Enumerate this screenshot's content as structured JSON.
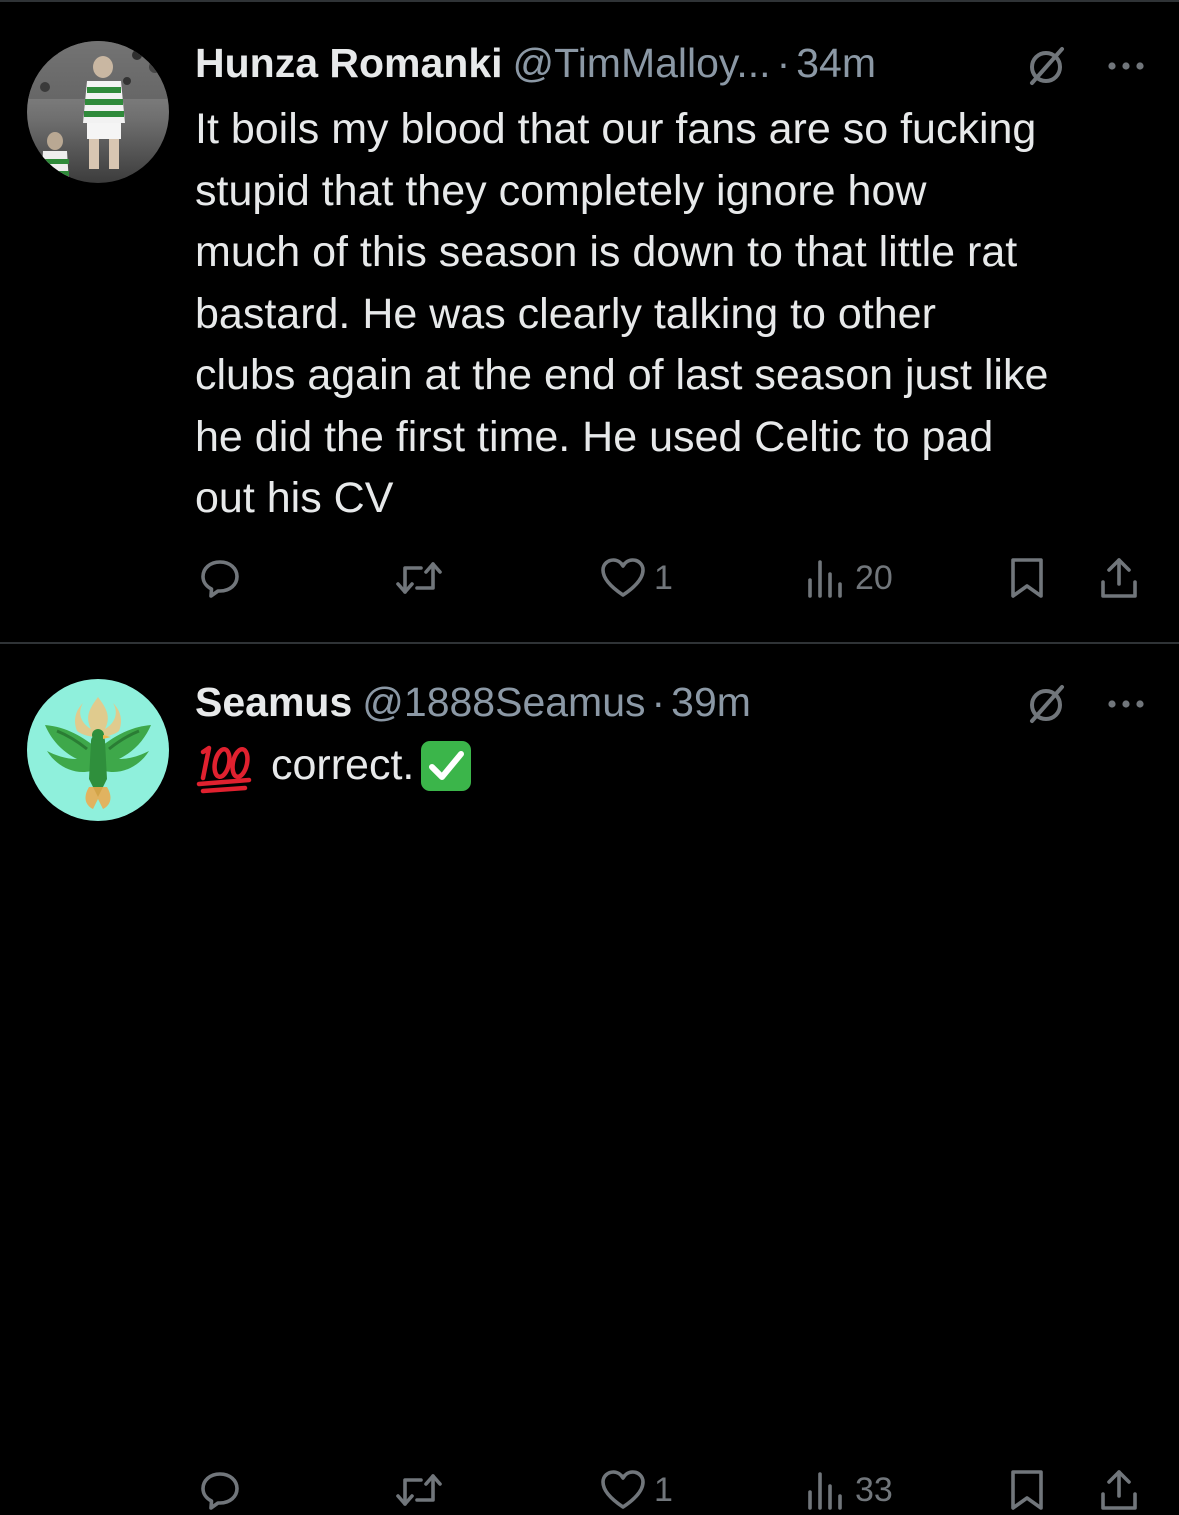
{
  "tweets": [
    {
      "author_name": "Hunza Romanki",
      "handle": "@TimMalloy...",
      "separator": "·",
      "time": "34m",
      "avatar_icon": "footballer-photo-avatar",
      "text_lines": [
        "It boils my blood that our fans are so fucking",
        "stupid that they completely ignore how",
        "much of this season is down to that little rat",
        "bastard. He was clearly talking to other",
        "clubs again at the end of last season just like",
        "he did the first time. He used Celtic to pad",
        "out his CV"
      ],
      "replies": "",
      "retweets": "",
      "likes": "1",
      "views": "20"
    },
    {
      "author_name": "Seamus",
      "handle": "@1888Seamus",
      "separator": "·",
      "time": "39m",
      "avatar_icon": "green-phoenix-avatar",
      "text": "correct.",
      "emoji_before": "💯",
      "emoji_after": "✅",
      "replies": "",
      "retweets": "",
      "likes": "1",
      "views": "33"
    }
  ],
  "colors": {
    "background": "#000000",
    "text": "#e7e9ea",
    "muted": "#71767b",
    "handle": "#8b98a5",
    "divider": "#2f3336",
    "check_green": "#3bb54a",
    "hundred_red": "#e0212f"
  }
}
